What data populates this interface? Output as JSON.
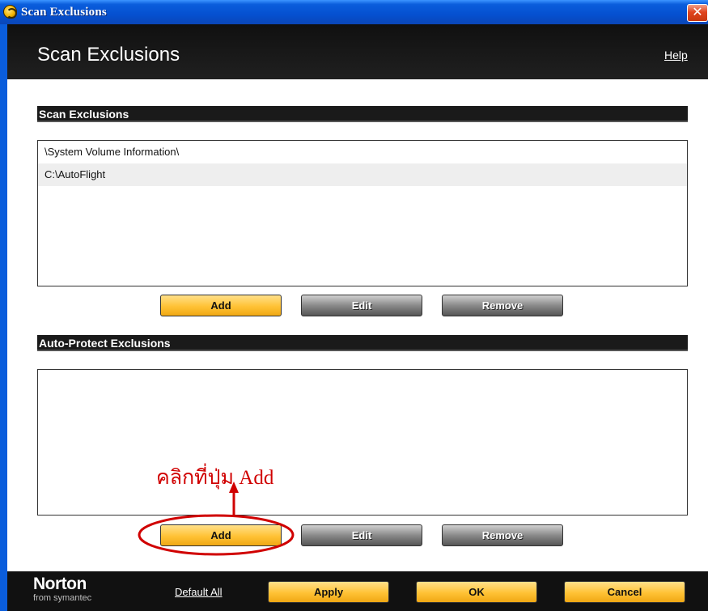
{
  "window": {
    "title": "Scan Exclusions",
    "close_glyph": "✕",
    "icon": "norton-globe-icon"
  },
  "header": {
    "title": "Scan Exclusions",
    "help_label": "Help"
  },
  "scan_exclusions": {
    "section_label": "Scan Exclusions",
    "items": [
      {
        "path": "\\System Volume Information\\"
      },
      {
        "path": "C:\\AutoFlight"
      }
    ],
    "buttons": {
      "add": "Add",
      "edit": "Edit",
      "remove": "Remove"
    }
  },
  "auto_protect_exclusions": {
    "section_label": "Auto-Protect Exclusions",
    "items": [],
    "buttons": {
      "add": "Add",
      "edit": "Edit",
      "remove": "Remove"
    }
  },
  "annotation": {
    "text": "คลิกที่ปุ่ม Add",
    "color": "#d00000"
  },
  "footer": {
    "brand": "Norton",
    "brand_sub": "from symantec",
    "default_all_label": "Default All",
    "apply_label": "Apply",
    "ok_label": "OK",
    "cancel_label": "Cancel"
  },
  "colors": {
    "accent_yellow": "#ffc235",
    "header_black": "#111111",
    "titlebar_blue": "#0550d0"
  }
}
